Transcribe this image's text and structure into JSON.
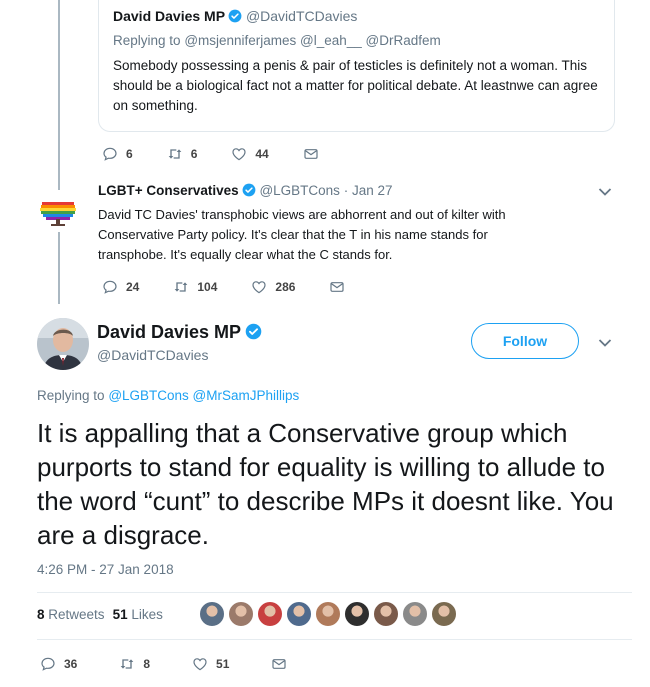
{
  "quoted_tweet": {
    "name": "David Davies MP",
    "handle": "@DavidTCDavies",
    "replying_prefix": "Replying to",
    "replying_to": "@msjenniferjames @l_eah__ @DrRadfem",
    "text": "Somebody possessing a penis & pair of testicles is definitely not a woman. This should be a biological fact not a matter for political debate. At leastnwe can agree on something.",
    "actions": {
      "replies": "6",
      "retweets": "6",
      "likes": "44"
    }
  },
  "lgbt_tweet": {
    "name": "LGBT+ Conservatives",
    "handle": "@LGBTCons",
    "date": "· Jan 27",
    "text": "David TC Davies' transphobic views are abhorrent and out of kilter with Conservative Party policy. It's clear that the T in his name stands for transphobe. It's equally clear what the C stands for.",
    "actions": {
      "replies": "24",
      "retweets": "104",
      "likes": "286"
    }
  },
  "main_tweet": {
    "name": "David Davies MP",
    "handle": "@DavidTCDavies",
    "follow_label": "Follow",
    "replying_prefix": "Replying to",
    "replying_to": "@LGBTCons @MrSamJPhillips",
    "text": "It is appalling that a Conservative group which purports to stand for equality is willing to allude to the word “cunt” to describe MPs it doesnt like. You are a disgrace.",
    "timestamp": "4:26 PM - 27 Jan 2018",
    "retweets_count": "8",
    "retweets_label": "Retweets",
    "likes_count": "51",
    "likes_label": "Likes",
    "liker_colors": [
      "#5a6f86",
      "#9b7a6a",
      "#c84040",
      "#4f6a8d",
      "#b07a5a",
      "#2e2e2e",
      "#7a5a4a",
      "#8a8a8a",
      "#7a6a50"
    ],
    "actions": {
      "replies": "36",
      "retweets": "8",
      "likes": "51"
    }
  },
  "colors": {
    "accent": "#1da1f2",
    "secondary": "#657786",
    "text": "#14171a"
  },
  "icons": [
    "reply-icon",
    "retweet-icon",
    "like-icon",
    "message-icon",
    "verified-badge-icon",
    "chevron-down-icon"
  ]
}
